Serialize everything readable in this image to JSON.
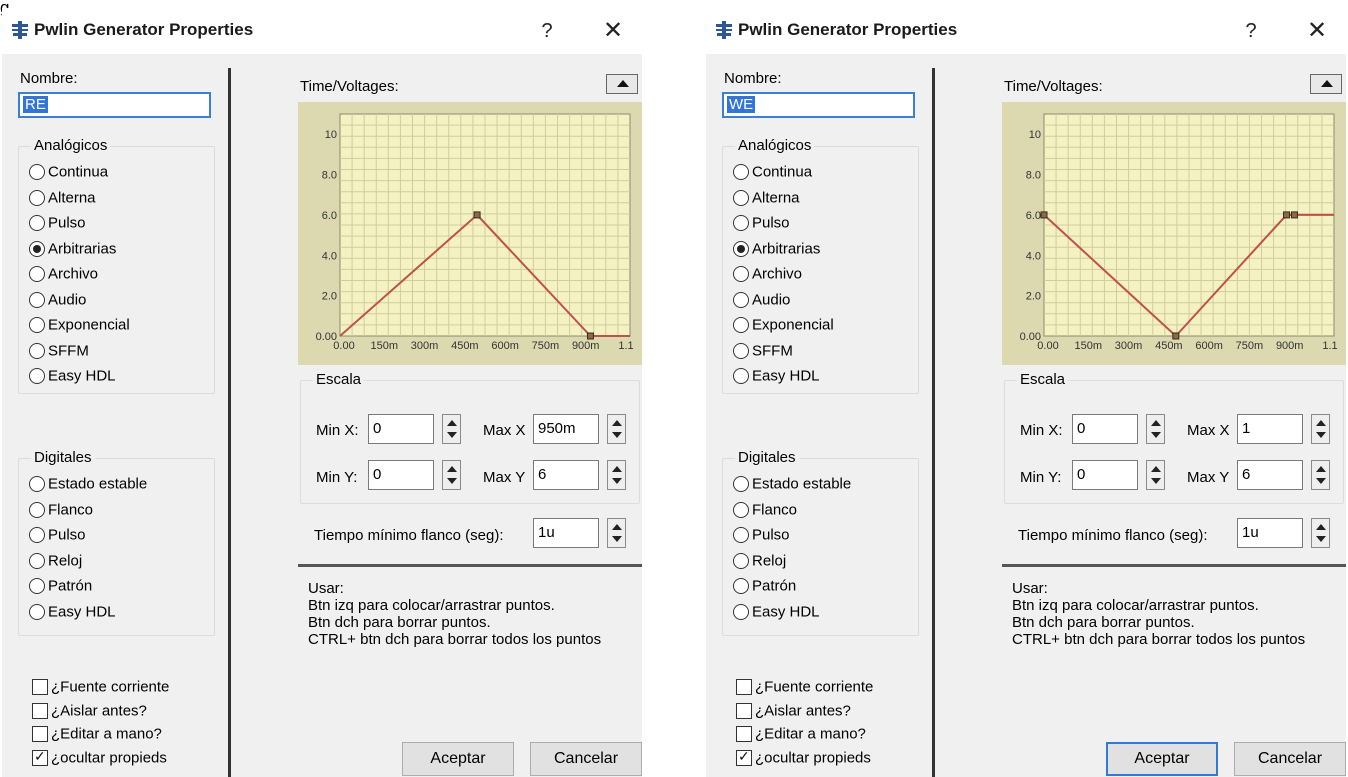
{
  "top_fragment": "g",
  "dialogs": [
    {
      "title": "Pwlin Generator Properties",
      "help": "?",
      "close": "✕",
      "nombre_label": "Nombre:",
      "nombre_value": "RE",
      "analog_title": "Analógicos",
      "analog": [
        {
          "label": "Continua",
          "checked": false
        },
        {
          "label": "Alterna",
          "checked": false
        },
        {
          "label": "Pulso",
          "checked": false
        },
        {
          "label": "Arbitrarias",
          "checked": true
        },
        {
          "label": "Archivo",
          "checked": false
        },
        {
          "label": "Audio",
          "checked": false
        },
        {
          "label": "Exponencial",
          "checked": false
        },
        {
          "label": "SFFM",
          "checked": false
        },
        {
          "label": "Easy HDL",
          "checked": false
        }
      ],
      "digital_title": "Digitales",
      "digital": [
        {
          "label": "Estado estable",
          "checked": false
        },
        {
          "label": "Flanco",
          "checked": false
        },
        {
          "label": "Pulso",
          "checked": false
        },
        {
          "label": "Reloj",
          "checked": false
        },
        {
          "label": "Patrón",
          "checked": false
        },
        {
          "label": "Easy HDL",
          "checked": false
        }
      ],
      "checks": [
        {
          "label": "¿Fuente corriente",
          "checked": false
        },
        {
          "label": "¿Aislar antes?",
          "checked": false
        },
        {
          "label": "¿Editar a mano?",
          "checked": false
        },
        {
          "label": "¿ocultar propieds",
          "checked": true
        }
      ],
      "tv_label": "Time/Voltages:",
      "escala_title": "Escala",
      "minx_label": "Min X:",
      "minx_value": "0",
      "maxx_label": "Max X",
      "maxx_value": "950m",
      "miny_label": "Min Y:",
      "miny_value": "0",
      "maxy_label": "Max Y",
      "maxy_value": "6",
      "tmin_label": "Tiempo mínimo flanco (seg):",
      "tmin_value": "1u",
      "usage": [
        "Usar:",
        "Btn izq para colocar/arrastrar puntos.",
        "Btn dch para borrar puntos.",
        "CTRL+ btn dch para borrar todos los puntos"
      ],
      "ok": "Aceptar",
      "cancel": "Cancelar",
      "ok_default": false,
      "chart_data": {
        "type": "line",
        "x_ticks": [
          "0.00",
          "150m",
          "300m",
          "450m",
          "600m",
          "750m",
          "900m",
          "1.1"
        ],
        "y_ticks": [
          "0.00",
          "2.0",
          "4.0",
          "6.0",
          "8.0",
          "10"
        ],
        "xlim": [
          0,
          1.1
        ],
        "ylim": [
          0,
          11
        ],
        "series": [
          {
            "x": [
              0,
              0.52,
              0.95,
              1.1
            ],
            "y": [
              0,
              6,
              0,
              0
            ]
          }
        ],
        "markers": [
          0.52,
          0.95
        ],
        "line_color": "#c0504d",
        "plot_bg": "#f4f2c2",
        "grid_color": "#cfcd9a"
      }
    },
    {
      "title": "Pwlin Generator Properties",
      "help": "?",
      "close": "✕",
      "nombre_label": "Nombre:",
      "nombre_value": "WE",
      "analog_title": "Analógicos",
      "analog": [
        {
          "label": "Continua",
          "checked": false
        },
        {
          "label": "Alterna",
          "checked": false
        },
        {
          "label": "Pulso",
          "checked": false
        },
        {
          "label": "Arbitrarias",
          "checked": true
        },
        {
          "label": "Archivo",
          "checked": false
        },
        {
          "label": "Audio",
          "checked": false
        },
        {
          "label": "Exponencial",
          "checked": false
        },
        {
          "label": "SFFM",
          "checked": false
        },
        {
          "label": "Easy HDL",
          "checked": false
        }
      ],
      "digital_title": "Digitales",
      "digital": [
        {
          "label": "Estado estable",
          "checked": false
        },
        {
          "label": "Flanco",
          "checked": false
        },
        {
          "label": "Pulso",
          "checked": false
        },
        {
          "label": "Reloj",
          "checked": false
        },
        {
          "label": "Patrón",
          "checked": false
        },
        {
          "label": "Easy HDL",
          "checked": false
        }
      ],
      "checks": [
        {
          "label": "¿Fuente corriente",
          "checked": false
        },
        {
          "label": "¿Aislar antes?",
          "checked": false
        },
        {
          "label": "¿Editar a mano?",
          "checked": false
        },
        {
          "label": "¿ocultar propieds",
          "checked": true
        }
      ],
      "tv_label": "Time/Voltages:",
      "escala_title": "Escala",
      "minx_label": "Min X:",
      "minx_value": "0",
      "maxx_label": "Max X",
      "maxx_value": "1",
      "miny_label": "Min Y:",
      "miny_value": "0",
      "maxy_label": "Max Y",
      "maxy_value": "6",
      "tmin_label": "Tiempo mínimo flanco (seg):",
      "tmin_value": "1u",
      "usage": [
        "Usar:",
        "Btn izq para colocar/arrastrar puntos.",
        "Btn dch para borrar puntos.",
        "CTRL+ btn dch para borrar todos los puntos"
      ],
      "ok": "Aceptar",
      "cancel": "Cancelar",
      "ok_default": true,
      "chart_data": {
        "type": "line",
        "x_ticks": [
          "0.00",
          "150m",
          "300m",
          "450m",
          "600m",
          "750m",
          "900m",
          "1.1"
        ],
        "y_ticks": [
          "0.00",
          "2.0",
          "4.0",
          "6.0",
          "8.0",
          "10"
        ],
        "xlim": [
          0,
          1.1
        ],
        "ylim": [
          0,
          11
        ],
        "series": [
          {
            "x": [
              0,
              0.5,
              0.92,
              0.95,
              1.1
            ],
            "y": [
              6,
              0,
              6,
              6,
              6
            ]
          }
        ],
        "markers": [
          0,
          0.5,
          0.92,
          0.95
        ],
        "line_color": "#c0504d",
        "plot_bg": "#f4f2c2",
        "grid_color": "#cfcd9a"
      }
    }
  ]
}
